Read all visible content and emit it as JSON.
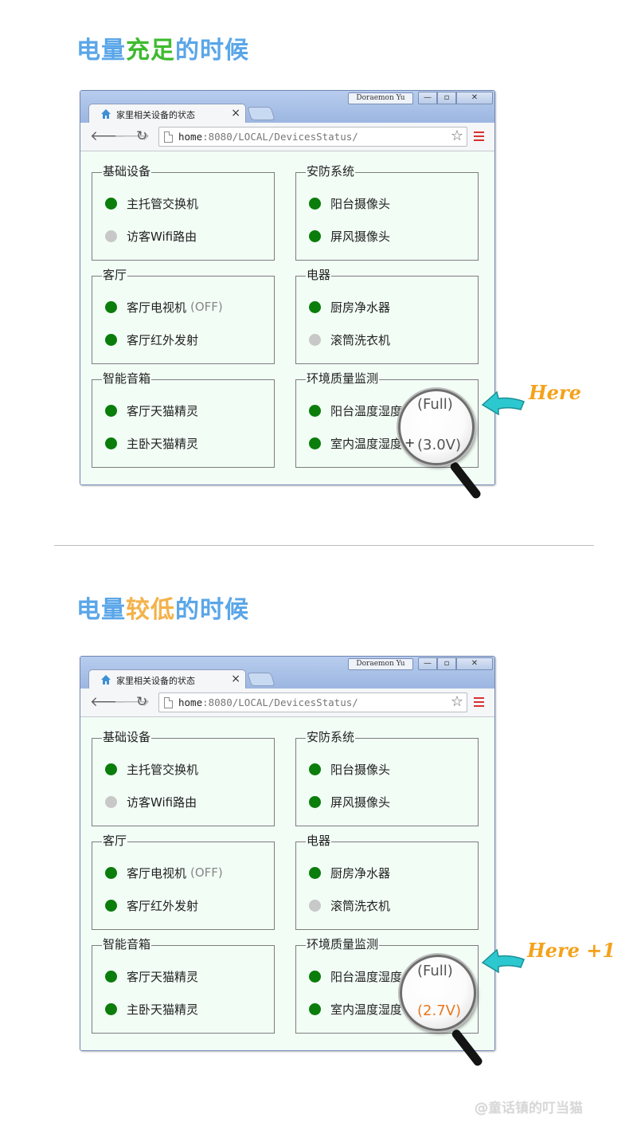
{
  "panels": [
    {
      "heading": {
        "prefix": "电量",
        "highlight": "充足",
        "suffix": "的时候",
        "highlight_color": "#3dbb2f"
      },
      "window": {
        "user": "Doraemon Yu"
      },
      "tab": {
        "title": "家里相关设备的状态",
        "close": "×"
      },
      "address": {
        "host": "home",
        "path": ":8080/LOCAL/DevicesStatus/"
      },
      "groups": [
        {
          "title": "基础设备",
          "items": [
            {
              "name": "主托管交换机",
              "extra": "",
              "status": "online"
            },
            {
              "name": "访客Wifi路由",
              "extra": "",
              "status": "offline"
            }
          ]
        },
        {
          "title": "安防系统",
          "items": [
            {
              "name": "阳台摄像头",
              "extra": "",
              "status": "online"
            },
            {
              "name": "屏风摄像头",
              "extra": "",
              "status": "online"
            }
          ]
        },
        {
          "title": "客厅",
          "items": [
            {
              "name": "客厅电视机",
              "extra": "(OFF)",
              "status": "online"
            },
            {
              "name": "客厅红外发射",
              "extra": "",
              "status": "online"
            }
          ]
        },
        {
          "title": "电器",
          "items": [
            {
              "name": "厨房净水器",
              "extra": "",
              "status": "online"
            },
            {
              "name": "滚筒洗衣机",
              "extra": "",
              "status": "offline"
            }
          ]
        },
        {
          "title": "智能音箱",
          "items": [
            {
              "name": "客厅天猫精灵",
              "extra": "",
              "status": "online"
            },
            {
              "name": "主卧天猫精灵",
              "extra": "",
              "status": "online"
            }
          ]
        },
        {
          "title": "环境质量监测",
          "items": [
            {
              "name": "阳台温度湿度",
              "extra": "",
              "status": "online"
            },
            {
              "name": "室内温度湿度",
              "extra": "",
              "status": "online"
            }
          ]
        }
      ],
      "magnifier": {
        "battery_state": "(Full)",
        "voltage": "(3.0V)",
        "voltage_color": "#555555",
        "plus": "+"
      },
      "callout": "Here"
    },
    {
      "heading": {
        "prefix": "电量",
        "highlight": "较低",
        "suffix": "的时候",
        "highlight_color": "#f3b24a"
      },
      "window": {
        "user": "Doraemon Yu"
      },
      "tab": {
        "title": "家里相关设备的状态",
        "close": "×"
      },
      "address": {
        "host": "home",
        "path": ":8080/LOCAL/DevicesStatus/"
      },
      "groups": [
        {
          "title": "基础设备",
          "items": [
            {
              "name": "主托管交换机",
              "extra": "",
              "status": "online"
            },
            {
              "name": "访客Wifi路由",
              "extra": "",
              "status": "offline"
            }
          ]
        },
        {
          "title": "安防系统",
          "items": [
            {
              "name": "阳台摄像头",
              "extra": "",
              "status": "online"
            },
            {
              "name": "屏风摄像头",
              "extra": "",
              "status": "online"
            }
          ]
        },
        {
          "title": "客厅",
          "items": [
            {
              "name": "客厅电视机",
              "extra": "(OFF)",
              "status": "online"
            },
            {
              "name": "客厅红外发射",
              "extra": "",
              "status": "online"
            }
          ]
        },
        {
          "title": "电器",
          "items": [
            {
              "name": "厨房净水器",
              "extra": "",
              "status": "online"
            },
            {
              "name": "滚筒洗衣机",
              "extra": "",
              "status": "offline"
            }
          ]
        },
        {
          "title": "智能音箱",
          "items": [
            {
              "name": "客厅天猫精灵",
              "extra": "",
              "status": "online"
            },
            {
              "name": "主卧天猫精灵",
              "extra": "",
              "status": "online"
            }
          ]
        },
        {
          "title": "环境质量监测",
          "items": [
            {
              "name": "阳台温度湿度",
              "extra": "",
              "status": "online"
            },
            {
              "name": "室内温度湿度",
              "extra": "",
              "status": "online"
            }
          ]
        }
      ],
      "magnifier": {
        "battery_state": "(Full)",
        "voltage": "(2.7V)",
        "voltage_color": "#e8781e",
        "plus": ""
      },
      "callout": "Here +1"
    }
  ],
  "status_colors": {
    "online": "#0a7d0a",
    "offline": "#c8c8c8"
  },
  "title_color": "#5aa6e8",
  "watermark": "@童话镇的叮当猫"
}
